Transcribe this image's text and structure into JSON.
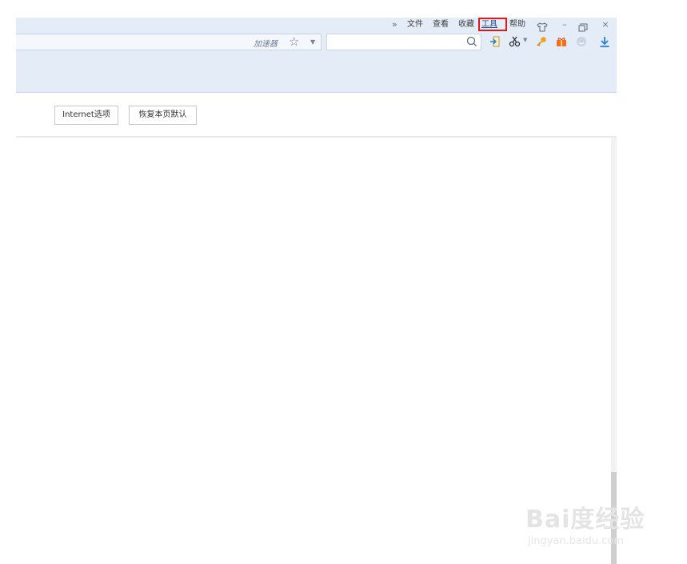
{
  "menu": {
    "overflow": "»",
    "items": [
      "文件",
      "查看",
      "收藏",
      "工具",
      "帮助"
    ],
    "highlighted": "工具"
  },
  "window_controls": {
    "skin_icon": "shirt-icon",
    "minimize": "–",
    "restore": "ª",
    "close": "×"
  },
  "toolbar": {
    "accelerator_label": "加速器",
    "favorite_icon": "star-icon",
    "dropdown_icon": "caret-down-icon",
    "search_placeholder": "",
    "search_icon": "search-icon",
    "icons": [
      "login-icon",
      "scissors-icon",
      "key-icon",
      "gift-icon",
      "smiley-icon",
      "download-icon"
    ]
  },
  "content": {
    "internet_options_label": "Internet选项",
    "restore_defaults_label": "恢复本页默认"
  },
  "watermark": {
    "logo": "Bai度经验",
    "url": "jingyan.baidu.com"
  },
  "colors": {
    "chrome_bg": "#e3ecf7",
    "highlight": "#e01818",
    "accent_blue": "#2a7fd6"
  }
}
